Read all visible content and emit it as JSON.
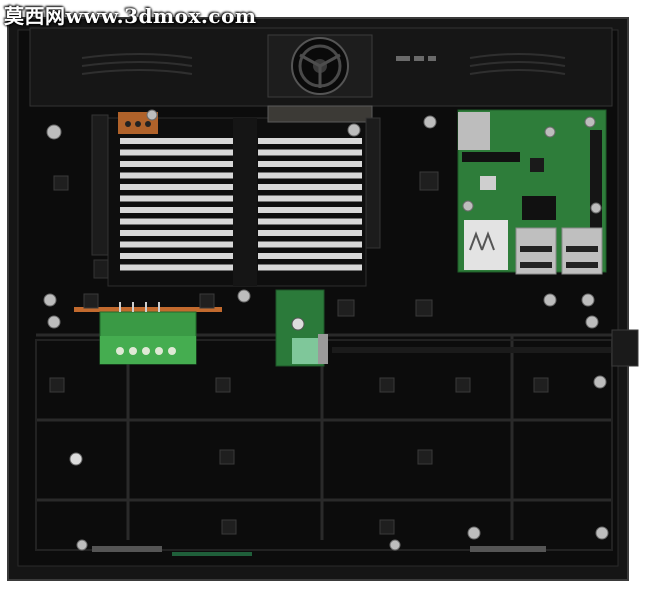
{
  "watermark": {
    "text": "莫西网www.3dmox.com"
  },
  "colors": {
    "enclosure": "#121212",
    "enclosure_edge": "#2c2c2c",
    "pcb_green": "#2e7a3a",
    "terminal_green": "#3fa24a",
    "heatsink_fin": "#d8d8d8",
    "copper": "#c26a2e",
    "screw": "#bdbdbd"
  },
  "components": {
    "fan": "cooling-fan",
    "heatsink": "heatsink-fins",
    "terminal_block": "green-5-pin-terminal-block",
    "sbc": "single-board-computer",
    "usb_ports": "dual-usb-ports",
    "module_board": "small-pcb-module"
  }
}
